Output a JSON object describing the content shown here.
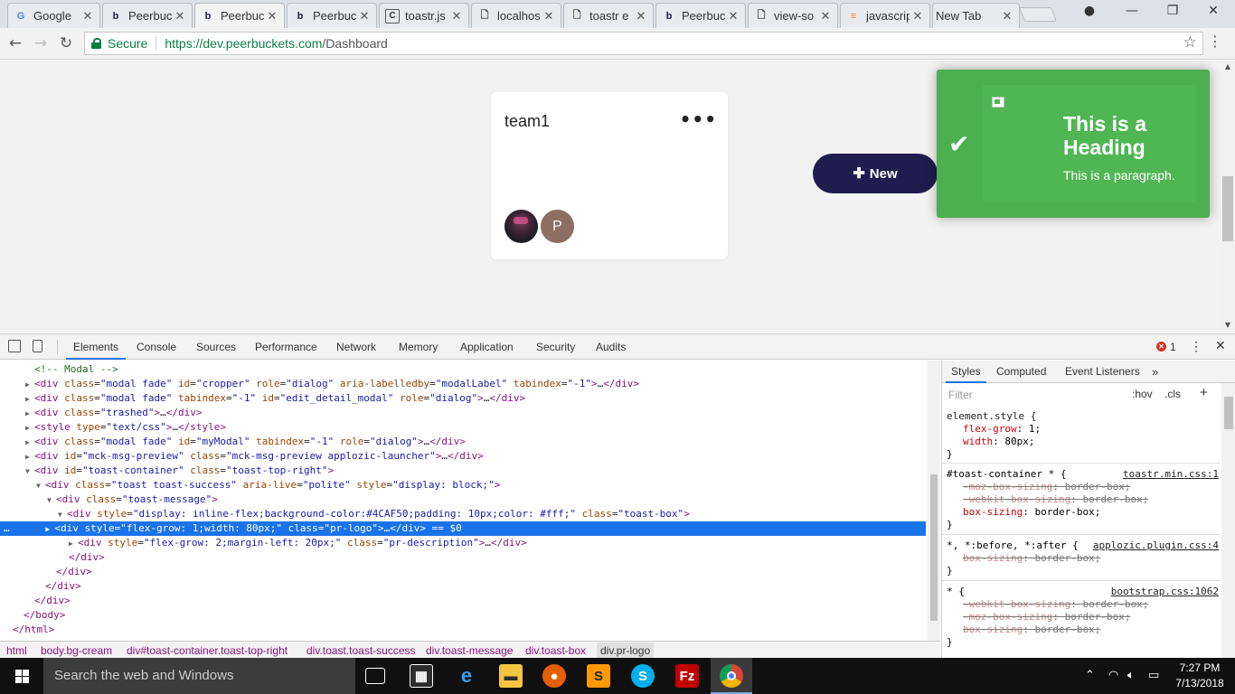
{
  "browser": {
    "tabs": [
      {
        "label": "Google",
        "icon": "google-icon",
        "active": false
      },
      {
        "label": "Peerbuc",
        "icon": "peerbuckets-icon",
        "active": false
      },
      {
        "label": "Peerbuc",
        "icon": "peerbuckets-icon",
        "active": true
      },
      {
        "label": "Peerbuc",
        "icon": "peerbuckets-icon",
        "active": false
      },
      {
        "label": "toastr.js",
        "icon": "c-letter-icon",
        "active": false
      },
      {
        "label": "localhos",
        "icon": "page-icon",
        "active": false
      },
      {
        "label": "toastr e",
        "icon": "page-icon",
        "active": false
      },
      {
        "label": "Peerbuc",
        "icon": "peerbuckets-icon",
        "active": false
      },
      {
        "label": "view-so",
        "icon": "page-icon",
        "active": false
      },
      {
        "label": "javascrip",
        "icon": "stackoverflow-icon",
        "active": false
      },
      {
        "label": "New Tab",
        "icon": "",
        "active": false
      }
    ],
    "secure_label": "Secure",
    "url_scheme_host": "https://dev.peerbuckets.com",
    "url_path": "/Dashboard"
  },
  "page": {
    "team_card": {
      "name": "team1",
      "avatar_letter": "P"
    },
    "new_button": "New",
    "toast": {
      "heading": "This is a Heading",
      "paragraph": "This is a paragraph."
    }
  },
  "devtools": {
    "tabs": [
      "Elements",
      "Console",
      "Sources",
      "Performance",
      "Network",
      "Memory",
      "Application",
      "Security",
      "Audits"
    ],
    "active_tab": "Elements",
    "error_count": "1",
    "styles_tabs": [
      "Styles",
      "Computed",
      "Event Listeners"
    ],
    "filter_placeholder": "Filter",
    "hov_label": ":hov",
    "cls_label": ".cls",
    "breadcrumbs": [
      "html",
      "body.bg-cream",
      "div#toast-container.toast-top-right",
      "div.toast.toast-success",
      "div.toast-message",
      "div.toast-box",
      "div.pr-logo"
    ]
  },
  "taskbar": {
    "search_placeholder": "Search the web and Windows",
    "time": "7:27 PM",
    "date": "7/13/2018"
  },
  "colors": {
    "toast_bg": "#4CAF50",
    "new_button_bg": "#1f1d4e",
    "selection_blue": "#1a73e8"
  }
}
